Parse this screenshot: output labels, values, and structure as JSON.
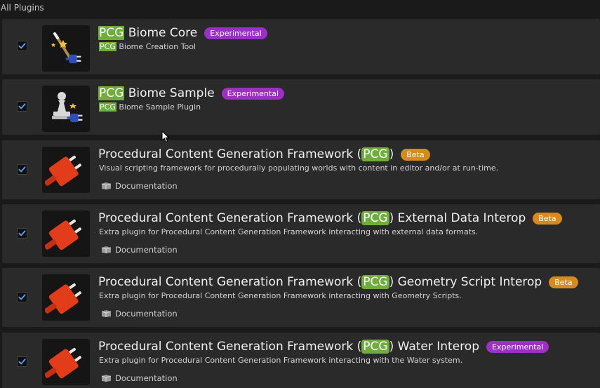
{
  "section": {
    "title": "All Plugins"
  },
  "plugins": [
    {
      "checked": true,
      "icon": "magic-wand-plug-icon",
      "title_prefix_hl": "PCG",
      "title_rest": " Biome Core",
      "badge": "Experimental",
      "desc_hl": "PCG",
      "desc_rest": " Biome Creation Tool"
    },
    {
      "checked": true,
      "icon": "pawn-plug-icon",
      "title_prefix_hl": "PCG",
      "title_rest": " Biome Sample",
      "badge": "Experimental",
      "desc_hl": "PCG",
      "desc_rest": " Biome Sample Plugin"
    },
    {
      "checked": true,
      "icon": "red-plug-icon",
      "title_pre": "Procedural Content Generation Framework (",
      "title_hl": "PCG",
      "title_post": ")",
      "badge": "Beta",
      "desc": "Visual scripting framework for procedurally populating worlds with content in editor and/or at run-time.",
      "doc": "Documentation"
    },
    {
      "checked": true,
      "icon": "red-plug-icon",
      "title_pre": "Procedural Content Generation Framework (",
      "title_hl": "PCG",
      "title_post": ") External Data Interop",
      "badge": "Beta",
      "desc": "Extra plugin for Procedural Content Generation Framework interacting with external data formats.",
      "doc": "Documentation"
    },
    {
      "checked": true,
      "icon": "red-plug-icon",
      "title_pre": "Procedural Content Generation Framework (",
      "title_hl": "PCG",
      "title_post": ") Geometry Script Interop",
      "badge": "Beta",
      "desc": "Extra plugin for Procedural Content Generation Framework interacting with Geometry Scripts.",
      "doc": "Documentation"
    },
    {
      "checked": true,
      "icon": "red-plug-icon",
      "title_pre": "Procedural Content Generation Framework (",
      "title_hl": "PCG",
      "title_post": ") Water Interop",
      "badge": "Experimental",
      "desc": "Extra plugin for Procedural Content Generation Framework interacting with the Water system.",
      "doc": "Documentation"
    }
  ],
  "colors": {
    "pcg_highlight": "#6fae3c",
    "experimental_badge": "#9c2fc6",
    "beta_badge": "#d98a1a",
    "checkbox_check": "#5aa0ff"
  }
}
